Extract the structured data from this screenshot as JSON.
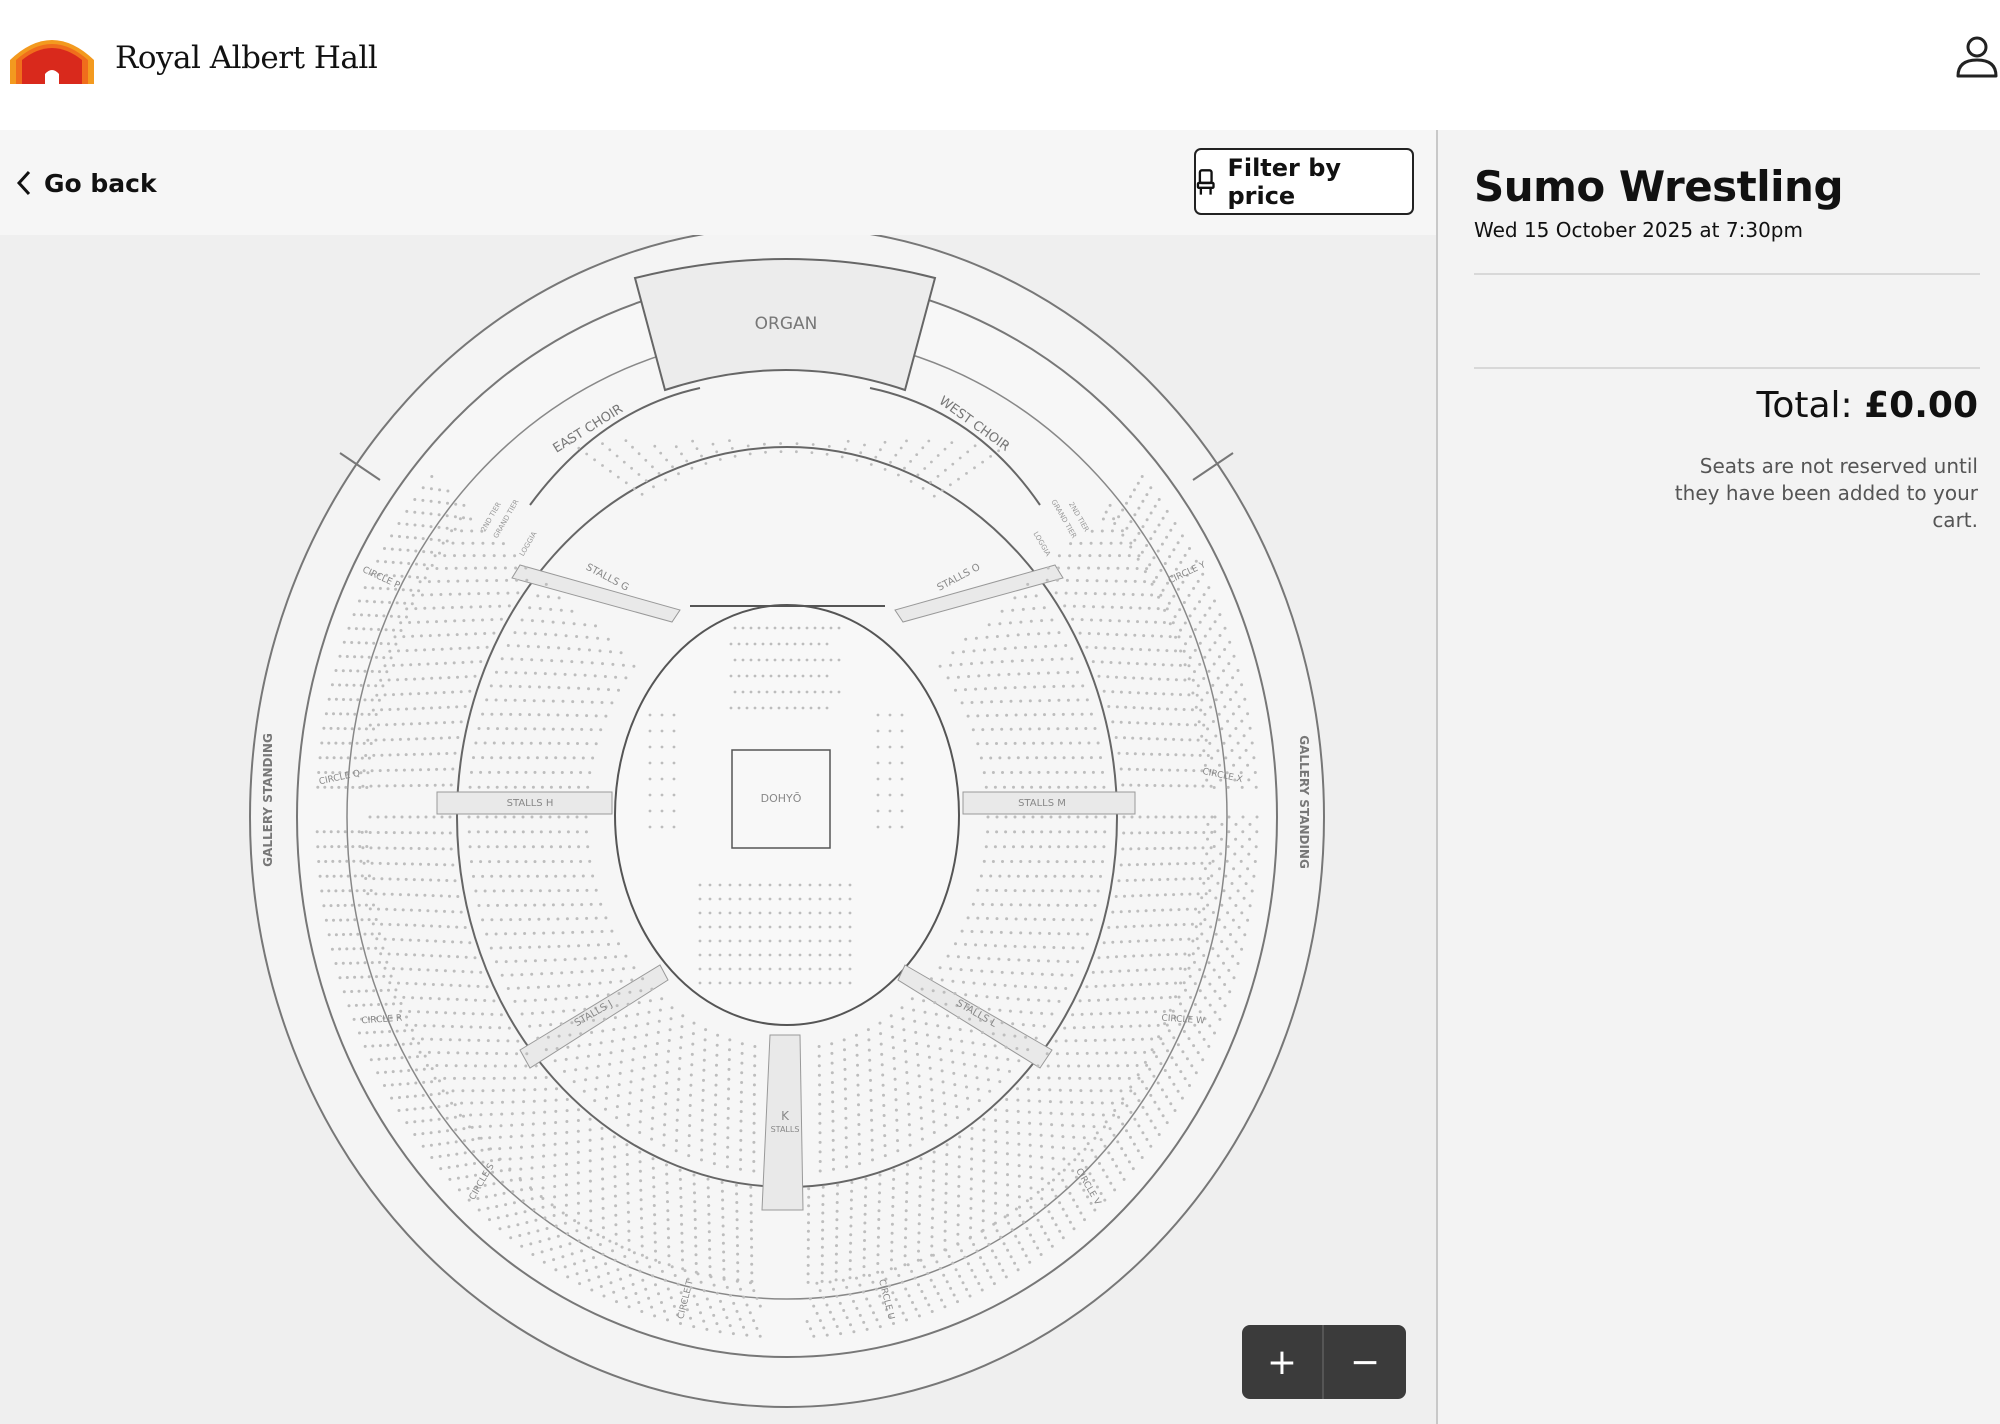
{
  "header": {
    "brand": "Royal Albert Hall",
    "logo_icon": "royal-albert-hall-logo",
    "account_icon": "user-icon"
  },
  "toolbar": {
    "back_label": "Go back",
    "filter_label": "Filter by price"
  },
  "event": {
    "title": "Sumo Wrestling",
    "date": "Wed 15 October 2025 at 7:30pm"
  },
  "cart": {
    "total_label": "Total:",
    "total_value": "£0.00",
    "note": "Seats are not reserved until they have been added to your cart."
  },
  "map": {
    "organ": "ORGAN",
    "east_choir": "EAST CHOIR",
    "west_choir": "WEST CHOIR",
    "dohyo": "DOHYŌ",
    "gallery_left": "GALLERY STANDING",
    "gallery_right": "GALLERY STANDING",
    "stalls_g": "STALLS G",
    "stalls_h": "STALLS H",
    "stalls_j": "STALLS J",
    "stalls_k": "K",
    "stalls_k_sub": "STALLS",
    "stalls_l": "STALLS L",
    "stalls_m": "STALLS M",
    "stalls_o": "STALLS O",
    "circle_p": "CIRCLE P",
    "circle_q": "CIRCLE Q",
    "circle_r": "CIRCLE R",
    "circle_s": "CIRCLE S",
    "circle_t": "CIRCLE T",
    "circle_u": "CIRCLE U",
    "circle_v": "CIRCLE V",
    "circle_w": "CIRCLE W",
    "circle_x": "CIRCLE X",
    "circle_y": "CIRCLE Y",
    "loggia_left": "LOGGIA",
    "loggia_right": "LOGGIA",
    "grand_tier_left": "GRAND TIER",
    "grand_tier_right": "GRAND TIER",
    "second_tier_left": "2ND TIER",
    "second_tier_right": "2ND TIER"
  },
  "zoom": {
    "in_label": "+",
    "out_label": "−"
  },
  "colors": {
    "panel": "#efefef",
    "sidebar": "#f3f3f3",
    "zoom_bg": "#3b3b3b",
    "seat": "#bdbdbd",
    "logo_red": "#d9291c",
    "logo_orange": "#f39a1f"
  }
}
